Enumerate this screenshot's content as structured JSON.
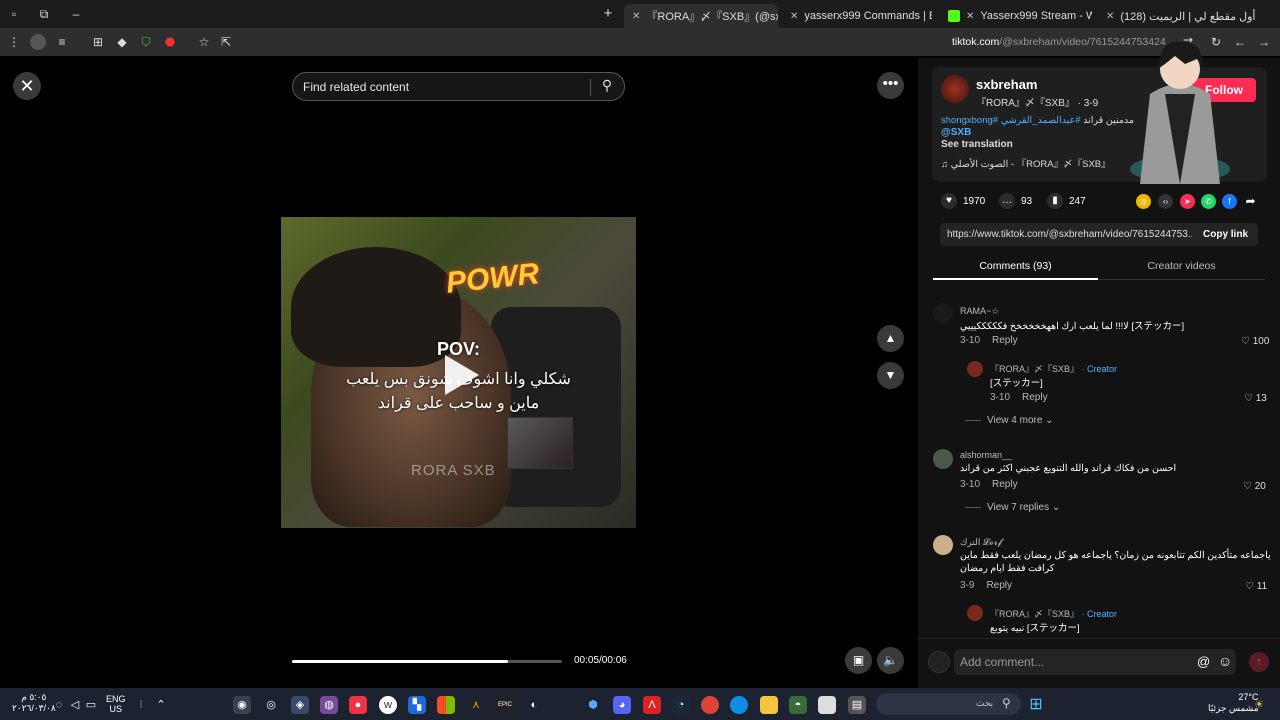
{
  "tabs": [
    {
      "label": "『RORA』〆『SXB』(@sxbreham)",
      "active": true
    },
    {
      "label": "yasserx999 Commands | BotRix"
    },
    {
      "label": "Yasserx999 Stream - Watch Live"
    },
    {
      "label": "(128) أول مقطع لي | الريميت"
    }
  ],
  "address": {
    "domain": "tiktok.com",
    "path": "/@sxbreham/video/7615244753424"
  },
  "search": {
    "placeholder": "Find related content"
  },
  "video": {
    "pov": "POV:",
    "caption_line1": "شكلي وانا اشوف شونق بس يلعب",
    "caption_line2": "ماين و ساحب على قراند",
    "brand": "POWR",
    "watermark": "RORA SXB",
    "time": "00:05/00:06",
    "progress": 0.8
  },
  "author": {
    "name": "sxbreham",
    "sub": "『RORA』〆『SXB』 · 3-9",
    "follow_label": "Follow",
    "desc_text": "مدمنين قراند",
    "tag1": "#عبدالصمد_القرشي",
    "tag2": "#shongxbong",
    "mention": "@SXB",
    "see_translation": "See translation",
    "music": "♫  الصوت الأصلي - 『RORA』〆『SXB』"
  },
  "stats": {
    "likes": "1970",
    "comments": "93",
    "saves": "247"
  },
  "share": {
    "link": "https://www.tiktok.com/@sxbreham/video/7615244753...",
    "copy_label": "Copy link"
  },
  "comment_tabs": {
    "comments": "Comments (93)",
    "creator": "Creator videos"
  },
  "comments": [
    {
      "name": "RAMA~☆",
      "text": "لا!!! لما يلعب ارك اههخخخخخخ فكككككيييي [ステッカー]",
      "date": "3-10",
      "reply": "Reply",
      "likes": "100"
    },
    {
      "name": "『RORA』〆『SXB』",
      "creator": "· Creator",
      "text": "[ステッカー]",
      "date": "3-10",
      "reply": "Reply",
      "likes": "13"
    },
    {
      "viewmore": "View 4 more ⌄"
    },
    {
      "name": "alshorman__",
      "text": "احسن من فكاك قراند والله التنويع عجبني اكثر من قراند",
      "date": "3-10",
      "reply": "Reply",
      "likes": "20"
    },
    {
      "viewmore": "View 7 replies ⌄"
    },
    {
      "name": "الترك 𝓛𝓸𝓻𝓯",
      "text": "ياجماعه متأكدين الكم تتابعونه من زمان؟ ياجماعه هو كل رمضان يلعب فقط ماين",
      "text2": "كرافت فقط ايام رمضان",
      "date": "3-9",
      "reply": "Reply",
      "likes": "11"
    },
    {
      "name": "『RORA』〆『SXB』",
      "creator": "· Creator",
      "text": "نبيه يتوبع [ステッカー]"
    }
  ],
  "add_comment": {
    "placeholder": "Add comment..."
  },
  "taskbar": {
    "lang": "ENG",
    "region": "US",
    "time": "٥:٠٥ م",
    "date": "٢٠٢٦/٠٣/٠٨",
    "weather_temp": "27°C",
    "weather_desc": "مشمس جزئيًا",
    "search_placeholder": "بحث"
  }
}
